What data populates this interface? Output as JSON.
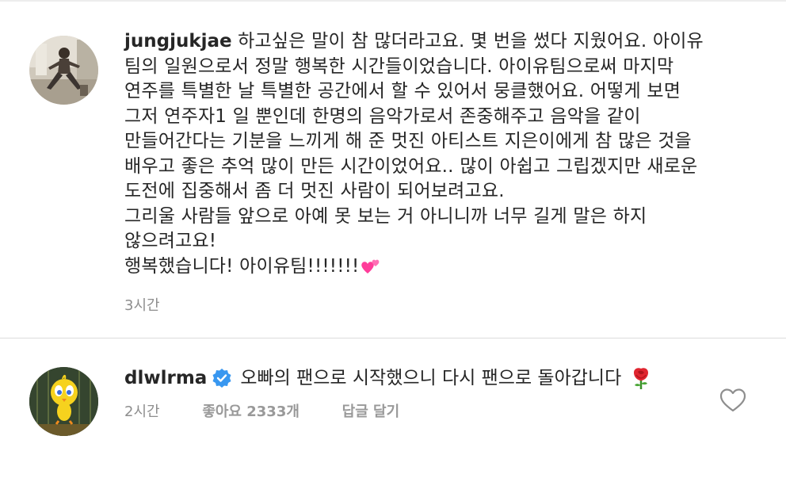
{
  "comments": [
    {
      "username": "jungjukjae",
      "avatar": "person-dancing-photo",
      "lines": [
        "하고싶은 말이 참 많더라고요. 몇 번을 썼다 지웠어요. 아이유",
        "팀의 일원으로서 정말 행복한 시간들이었습니다. 아이유팀으로써 마지막",
        "연주를 특별한 날 특별한 공간에서 할 수 있어서 뭉클했어요. 어떻게 보면",
        "그저 연주자1 일 뿐인데 한명의 음악가로서 존중해주고 음악을 같이",
        "만들어간다는 기분을 느끼게 해 준 멋진 아티스트 지은이에게 참 많은 것을",
        "배우고 좋은 추억 많이 만든 시간이었어요.. 많이 아쉽고 그립겠지만 새로운",
        "도전에 집중해서 좀 더 멋진 사람이 되어보려고요.",
        "그리울 사람들 앞으로 아예 못 보는 거 아니니까 너무 길게 말은 하지",
        "않으려고요!",
        "행복했습니다! 아이유팀!!!!!!!"
      ],
      "emoji": "two-hearts",
      "time": "3시간"
    },
    {
      "username": "dlwlrma",
      "verified": true,
      "avatar": "tweety-bird-cartoon",
      "text": "오빠의 팬으로 시작했으니 다시 팬으로 돌아갑니다",
      "emoji": "rose",
      "time": "2시간",
      "likes": "좋아요 2333개",
      "reply": "답글 달기"
    }
  ],
  "colors": {
    "text": "#262626",
    "meta": "#8e8e8e",
    "verified": "#3897f0",
    "emoji_heart": "#ff3d9a",
    "rose": "#e0252f"
  }
}
